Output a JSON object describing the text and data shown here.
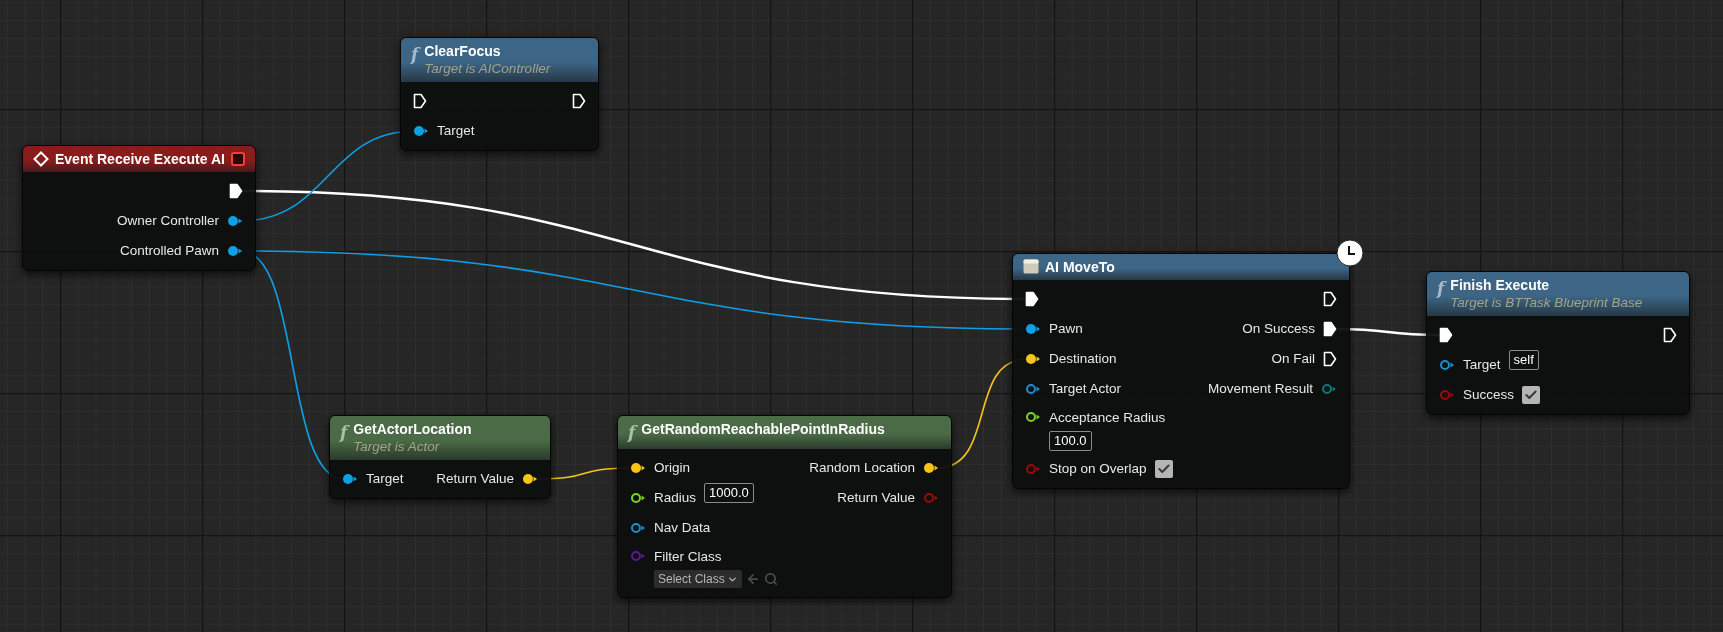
{
  "nodes": [
    {
      "kind": "event",
      "title": "Event Receive Execute AI",
      "color": "#8b1c1c",
      "outputs": [
        {
          "kind": "exec",
          "color": "#ffffff",
          "connected": true
        },
        {
          "kind": "data",
          "label": "Owner Controller",
          "color": "#0ea0e6",
          "connected": true
        },
        {
          "kind": "data",
          "label": "Controlled Pawn",
          "color": "#0ea0e6",
          "connected": true
        }
      ]
    },
    {
      "kind": "function",
      "glyph": "f",
      "title": "ClearFocus",
      "subtitle": "Target is AIController",
      "color": "#3d6585",
      "inputs": [
        {
          "kind": "exec",
          "color": "#ffffff",
          "connected": false
        },
        {
          "kind": "data",
          "label": "Target",
          "color": "#0ea0e6",
          "connected": true
        }
      ],
      "outputs": [
        {
          "kind": "exec",
          "color": "#ffffff",
          "connected": false
        }
      ]
    },
    {
      "kind": "function",
      "glyph": "f",
      "title": "GetActorLocation",
      "subtitle": "Target is Actor",
      "color": "#4a6b45",
      "inputs": [
        {
          "kind": "data",
          "label": "Target",
          "color": "#0ea0e6",
          "connected": true
        }
      ],
      "outputs": [
        {
          "kind": "data",
          "label": "Return Value",
          "color": "#f5c518",
          "connected": true
        }
      ]
    },
    {
      "kind": "function",
      "glyph": "f",
      "title": "GetRandomReachablePointInRadius",
      "color": "#4a6b45",
      "inputs": [
        {
          "kind": "data",
          "label": "Origin",
          "color": "#f5c518",
          "connected": true
        },
        {
          "kind": "data",
          "label": "Radius",
          "color": "#7ed321",
          "connected": false,
          "field": {
            "kind": "text",
            "value": "1000.0"
          }
        },
        {
          "kind": "data",
          "label": "Nav Data",
          "color": "#1a8fd0",
          "connected": false
        },
        {
          "kind": "data",
          "label": "Filter Class",
          "color": "#5a1a9e",
          "connected": false,
          "field": {
            "kind": "select",
            "value": "Select Class"
          }
        }
      ],
      "outputs": [
        {
          "kind": "data",
          "label": "Random Location",
          "color": "#f5c518",
          "connected": true
        },
        {
          "kind": "data",
          "label": "Return Value",
          "color": "#9a0a0a",
          "connected": false
        }
      ]
    },
    {
      "kind": "latent",
      "title": "AI MoveTo",
      "color": "#3d6585",
      "inputs": [
        {
          "kind": "exec",
          "color": "#ffffff",
          "connected": true
        },
        {
          "kind": "data",
          "label": "Pawn",
          "color": "#0ea0e6",
          "connected": true
        },
        {
          "kind": "data",
          "label": "Destination",
          "color": "#f5c518",
          "connected": true
        },
        {
          "kind": "data",
          "label": "Target Actor",
          "color": "#1a8fd0",
          "connected": false
        },
        {
          "kind": "data",
          "label": "Acceptance Radius",
          "color": "#7ed321",
          "connected": false,
          "field": {
            "kind": "text",
            "value": "100.0"
          }
        },
        {
          "kind": "data",
          "label": "Stop on Overlap",
          "color": "#9a0a0a",
          "connected": false,
          "field": {
            "kind": "checkbox",
            "checked": true
          }
        }
      ],
      "outputs": [
        {
          "kind": "exec",
          "color": "#ffffff",
          "connected": false
        },
        {
          "kind": "exec",
          "label": "On Success",
          "color": "#ffffff",
          "connected": true
        },
        {
          "kind": "exec",
          "label": "On Fail",
          "color": "#ffffff",
          "connected": false
        },
        {
          "kind": "data",
          "label": "Movement Result",
          "color": "#0b7a7a",
          "connected": false
        }
      ]
    },
    {
      "kind": "function",
      "glyph": "f",
      "title": "Finish Execute",
      "subtitle": "Target is BTTask Blueprint Base",
      "color": "#3d6585",
      "inputs": [
        {
          "kind": "exec",
          "color": "#ffffff",
          "connected": true
        },
        {
          "kind": "data",
          "label": "Target",
          "color": "#1a8fd0",
          "connected": false,
          "field": {
            "kind": "text",
            "value": "self"
          }
        },
        {
          "kind": "data",
          "label": "Success",
          "color": "#9a0a0a",
          "connected": false,
          "field": {
            "kind": "checkbox",
            "checked": true
          }
        }
      ],
      "outputs": [
        {
          "kind": "exec",
          "color": "#ffffff",
          "connected": false
        }
      ]
    }
  ]
}
